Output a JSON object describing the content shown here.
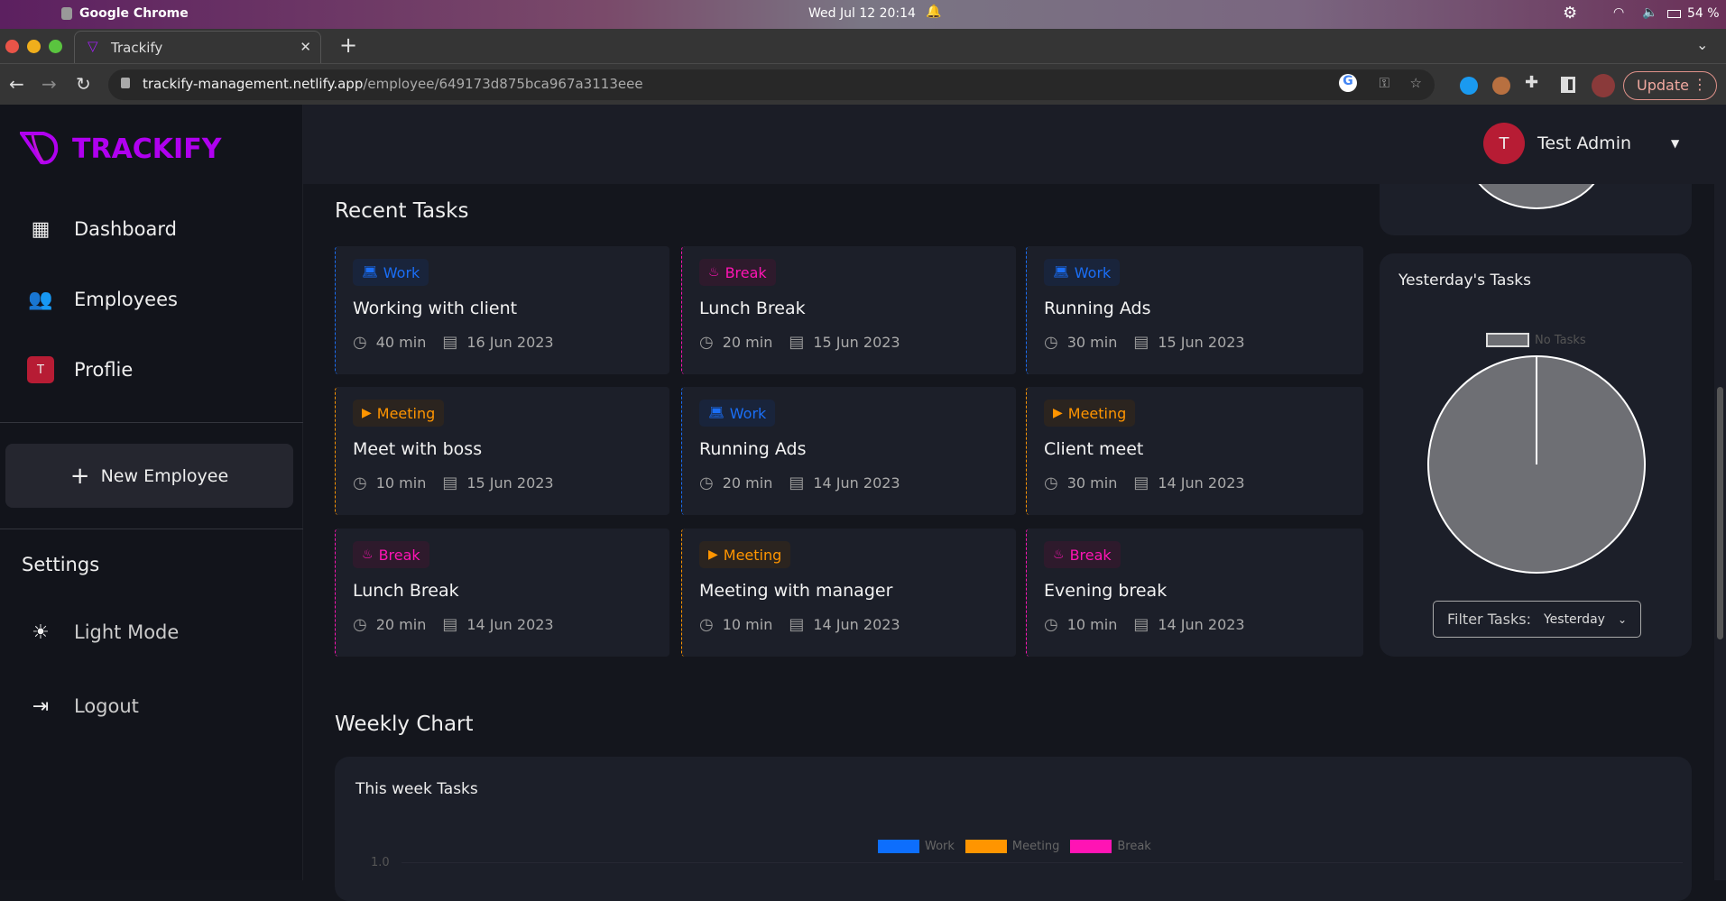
{
  "os": {
    "app": "Google Chrome",
    "datetime": "Wed Jul 12  20:14",
    "battery": "54 %"
  },
  "browser": {
    "tab_title": "Trackify",
    "url_host": "trackify-management.netlify.app",
    "url_path": "/employee/649173d875bca967a3113eee",
    "update_label": "Update"
  },
  "sidebar": {
    "brand": "TRACKIFY",
    "brand_color": "#b000f0",
    "items": [
      {
        "label": "Dashboard",
        "icon": "dashboard-icon"
      },
      {
        "label": "Employees",
        "icon": "people-icon"
      },
      {
        "label": "Proflie",
        "icon": "avatar-icon",
        "avatar_letter": "T"
      }
    ],
    "new_employee": "New Employee",
    "settings_title": "Settings",
    "light_mode": "Light Mode",
    "logout": "Logout"
  },
  "header": {
    "user_initial": "T",
    "user_name": "Test Admin"
  },
  "recent": {
    "title": "Recent Tasks",
    "tasks": [
      {
        "type": "Work",
        "title": "Working with client",
        "duration": "40 min",
        "date": "16 Jun 2023"
      },
      {
        "type": "Break",
        "title": "Lunch Break",
        "duration": "20 min",
        "date": "15 Jun 2023"
      },
      {
        "type": "Work",
        "title": "Running Ads",
        "duration": "30 min",
        "date": "15 Jun 2023"
      },
      {
        "type": "Meeting",
        "title": "Meet with boss",
        "duration": "10 min",
        "date": "15 Jun 2023"
      },
      {
        "type": "Work",
        "title": "Running Ads",
        "duration": "20 min",
        "date": "14 Jun 2023"
      },
      {
        "type": "Meeting",
        "title": "Client meet",
        "duration": "30 min",
        "date": "14 Jun 2023"
      },
      {
        "type": "Break",
        "title": "Lunch Break",
        "duration": "20 min",
        "date": "14 Jun 2023"
      },
      {
        "type": "Meeting",
        "title": "Meeting with manager",
        "duration": "10 min",
        "date": "14 Jun 2023"
      },
      {
        "type": "Break",
        "title": "Evening break",
        "duration": "10 min",
        "date": "14 Jun 2023"
      }
    ]
  },
  "type_colors": {
    "Work": "#1a6ef5",
    "Meeting": "#ff9500",
    "Break": "#ff14b4"
  },
  "yesterday": {
    "title": "Yesterday's Tasks",
    "filter_label": "Filter Tasks:",
    "filter_value": "Yesterday"
  },
  "weekly": {
    "section_title": "Weekly Chart"
  },
  "chart_data": [
    {
      "type": "pie",
      "title": "Yesterday's Tasks",
      "legend": [
        "No Tasks"
      ],
      "values": [
        1
      ],
      "colors": [
        "#6e6f74"
      ],
      "legend_position": "top"
    },
    {
      "type": "bar",
      "title": "This week Tasks",
      "series": [
        {
          "name": "Work",
          "color": "#0d6efd"
        },
        {
          "name": "Meeting",
          "color": "#ff9500"
        },
        {
          "name": "Break",
          "color": "#ff14b4"
        }
      ],
      "y_ticks": [
        "1.0"
      ],
      "legend_position": "top",
      "grid": true
    }
  ]
}
